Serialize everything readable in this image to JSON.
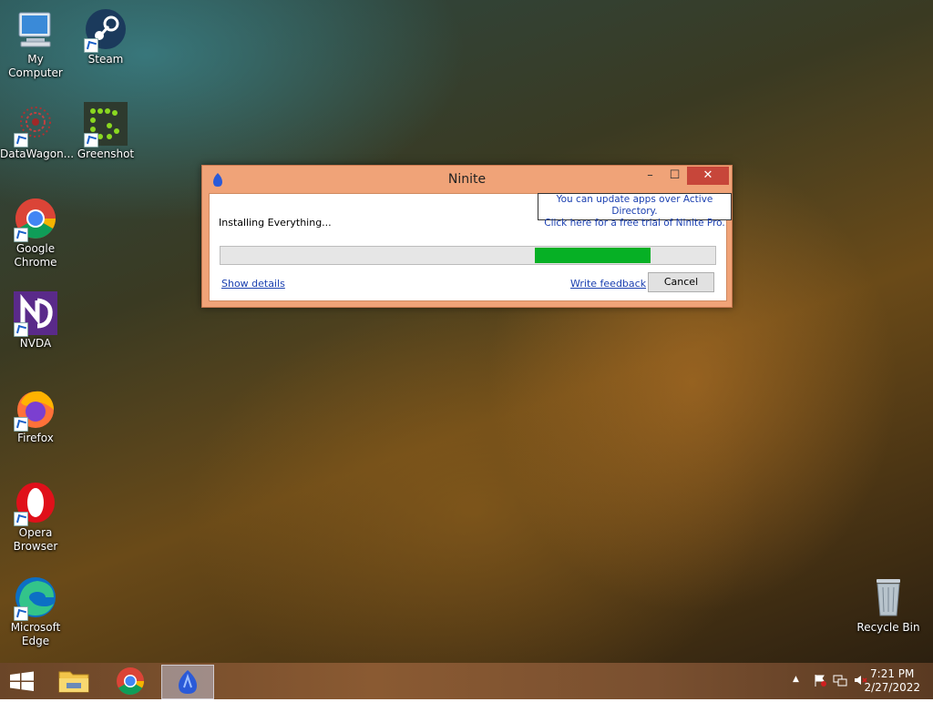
{
  "desktop": {
    "icons": [
      {
        "label": "My Computer"
      },
      {
        "label": "Steam"
      },
      {
        "label": "DataWagon..."
      },
      {
        "label": "Greenshot"
      },
      {
        "label": "Google Chrome"
      },
      {
        "label": "NVDA"
      },
      {
        "label": "Firefox"
      },
      {
        "label": "Opera Browser"
      },
      {
        "label": "Microsoft Edge"
      },
      {
        "label": "Recycle Bin"
      }
    ]
  },
  "dialog": {
    "title": "Ninite",
    "promo_line1": "You can update apps over Active Directory.",
    "promo_line2": "Click here for a free trial of Ninite Pro.",
    "status": "Installing Everything...",
    "show_details": "Show details",
    "write_feedback": "Write feedback",
    "cancel": "Cancel",
    "controls": {
      "minimize": "–",
      "maximize": "☐",
      "close": "✕"
    }
  },
  "taskbar": {
    "clock_time": "7:21 PM",
    "clock_date": "2/27/2022",
    "tray_chevron": "▲"
  },
  "colors": {
    "dialog_frame": "#f0a378",
    "progress_fill": "#06b025",
    "close_button": "#c7463a",
    "link": "#1a3fb0"
  }
}
